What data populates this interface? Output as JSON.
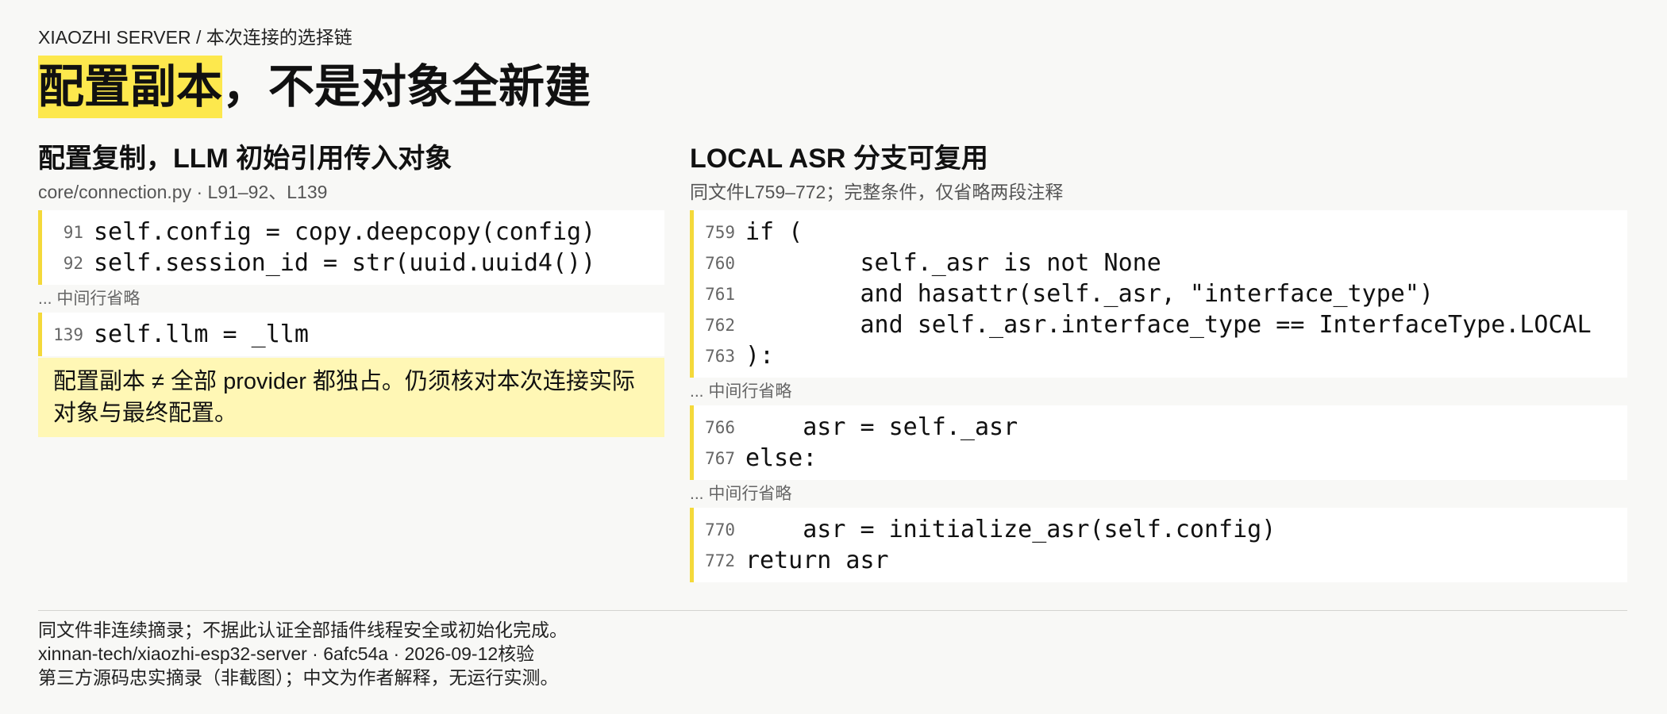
{
  "colors": {
    "title_highlight": "#fde84d",
    "code_bar": "#f4d93a",
    "note_background": "#fff7b5"
  },
  "breadcrumb": "XIAOZHI SERVER / 本次连接的选择链",
  "title": {
    "highlight": "配置副本",
    "rest": "，不是对象全新建"
  },
  "left": {
    "heading": "配置复制，LLM 初始引用传入对象",
    "source": "core/connection.py · L91–92、L139",
    "omitted": "... 中间行省略",
    "blocks": [
      {
        "lines": [
          {
            "n": "91",
            "code": "self.config = copy.deepcopy(config)"
          },
          {
            "n": "92",
            "code": "self.session_id = str(uuid.uuid4())"
          }
        ]
      },
      {
        "lines": [
          {
            "n": "139",
            "code": "self.llm = _llm"
          }
        ]
      }
    ],
    "note": "配置副本 ≠ 全部 provider 都独占。仍须核对本次连接实际对象与最终配置。"
  },
  "right": {
    "heading": "LOCAL ASR 分支可复用",
    "source": "同文件L759–772；完整条件，仅省略两段注释",
    "omitted": "... 中间行省略",
    "blocks": [
      {
        "lines": [
          {
            "n": "759",
            "code": "if ("
          },
          {
            "n": "760",
            "code": "        self._asr is not None"
          },
          {
            "n": "761",
            "code": "        and hasattr(self._asr, \"interface_type\")"
          },
          {
            "n": "762",
            "code": "        and self._asr.interface_type == InterfaceType.LOCAL"
          },
          {
            "n": "763",
            "code": "):"
          }
        ]
      },
      {
        "lines": [
          {
            "n": "766",
            "code": "    asr = self._asr"
          },
          {
            "n": "767",
            "code": "else:"
          }
        ]
      },
      {
        "lines": [
          {
            "n": "770",
            "code": "    asr = initialize_asr(self.config)"
          },
          {
            "n": "772",
            "code": "return asr"
          }
        ]
      }
    ]
  },
  "footer": {
    "disclaimer": "同文件非连续摘录；不据此认证全部插件线程安全或初始化完成。",
    "source": "xinnan-tech/xiaozhi-esp32-server · 6afc54a · 2026-09-12核验",
    "method": "第三方源码忠实摘录（非截图）；中文为作者解释，无运行实测。"
  }
}
